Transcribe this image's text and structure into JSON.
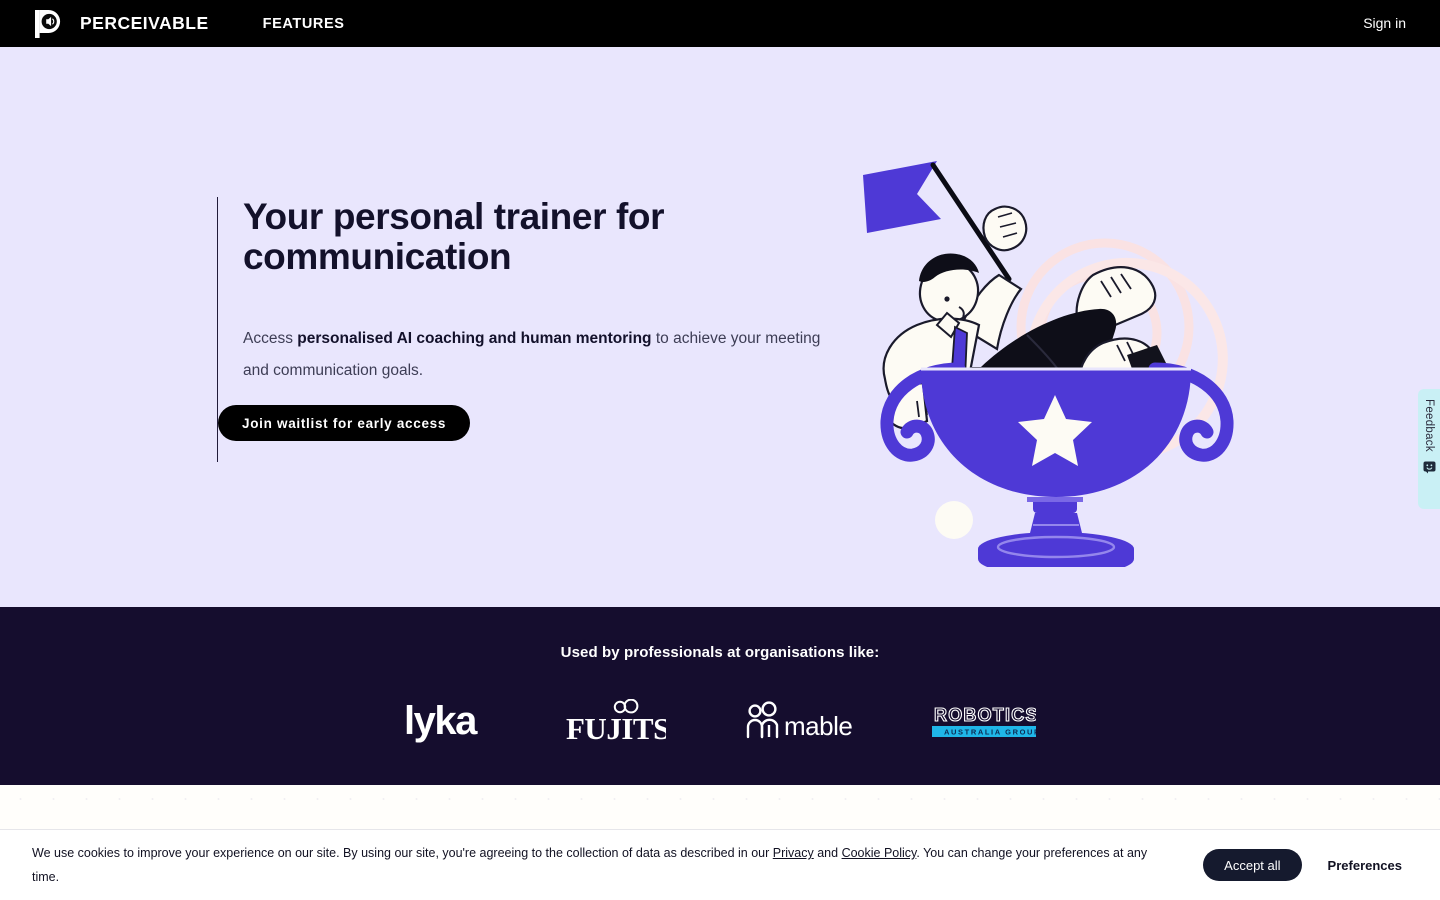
{
  "nav": {
    "brand_name": "PERCEIVABLE",
    "brand_icon": "perceivable-p-speaker-logo",
    "links": [
      {
        "label": "FEATURES"
      }
    ],
    "signin_label": "Sign in",
    "background_color": "#000000"
  },
  "hero": {
    "background_color": "#e9e6fd",
    "title": "Your personal trainer for communication",
    "subtitle_before": "Access ",
    "subtitle_bold": "personalised AI coaching and human mentoring",
    "subtitle_after": " to achieve your meeting and communication goals.",
    "cta_label": "Join waitlist for early access",
    "illustration": "person-in-trophy-cup-waving-flag",
    "accent_color": "#4e39d6"
  },
  "logos_section": {
    "background_color": "#150d2e",
    "title": "Used by professionals at organisations like:",
    "logos": [
      {
        "name": "lyka",
        "label": "lyka"
      },
      {
        "name": "fujitsu",
        "label": "FUJITSU"
      },
      {
        "name": "mable",
        "label": "mable"
      },
      {
        "name": "robotics-australia-group",
        "label": "ROBOTICS",
        "sublabel": "AUSTRALIA GROUP",
        "bar_color": "#1fb6e8"
      }
    ]
  },
  "cookie_banner": {
    "text_1": "We use cookies to improve your experience on our site. By using our site, you're agreeing to the collection of data as described in our ",
    "link_privacy": "Privacy",
    "text_2": " and ",
    "link_cookie_policy": "Cookie Policy",
    "text_3": ". You can change your preferences at any time.",
    "accept_label": "Accept all",
    "preferences_label": "Preferences",
    "accept_color": "#151a2e"
  },
  "feedback_tab": {
    "label": "Feedback",
    "icon": "smiley-feedback-icon",
    "background_color": "#c9f0f5"
  }
}
